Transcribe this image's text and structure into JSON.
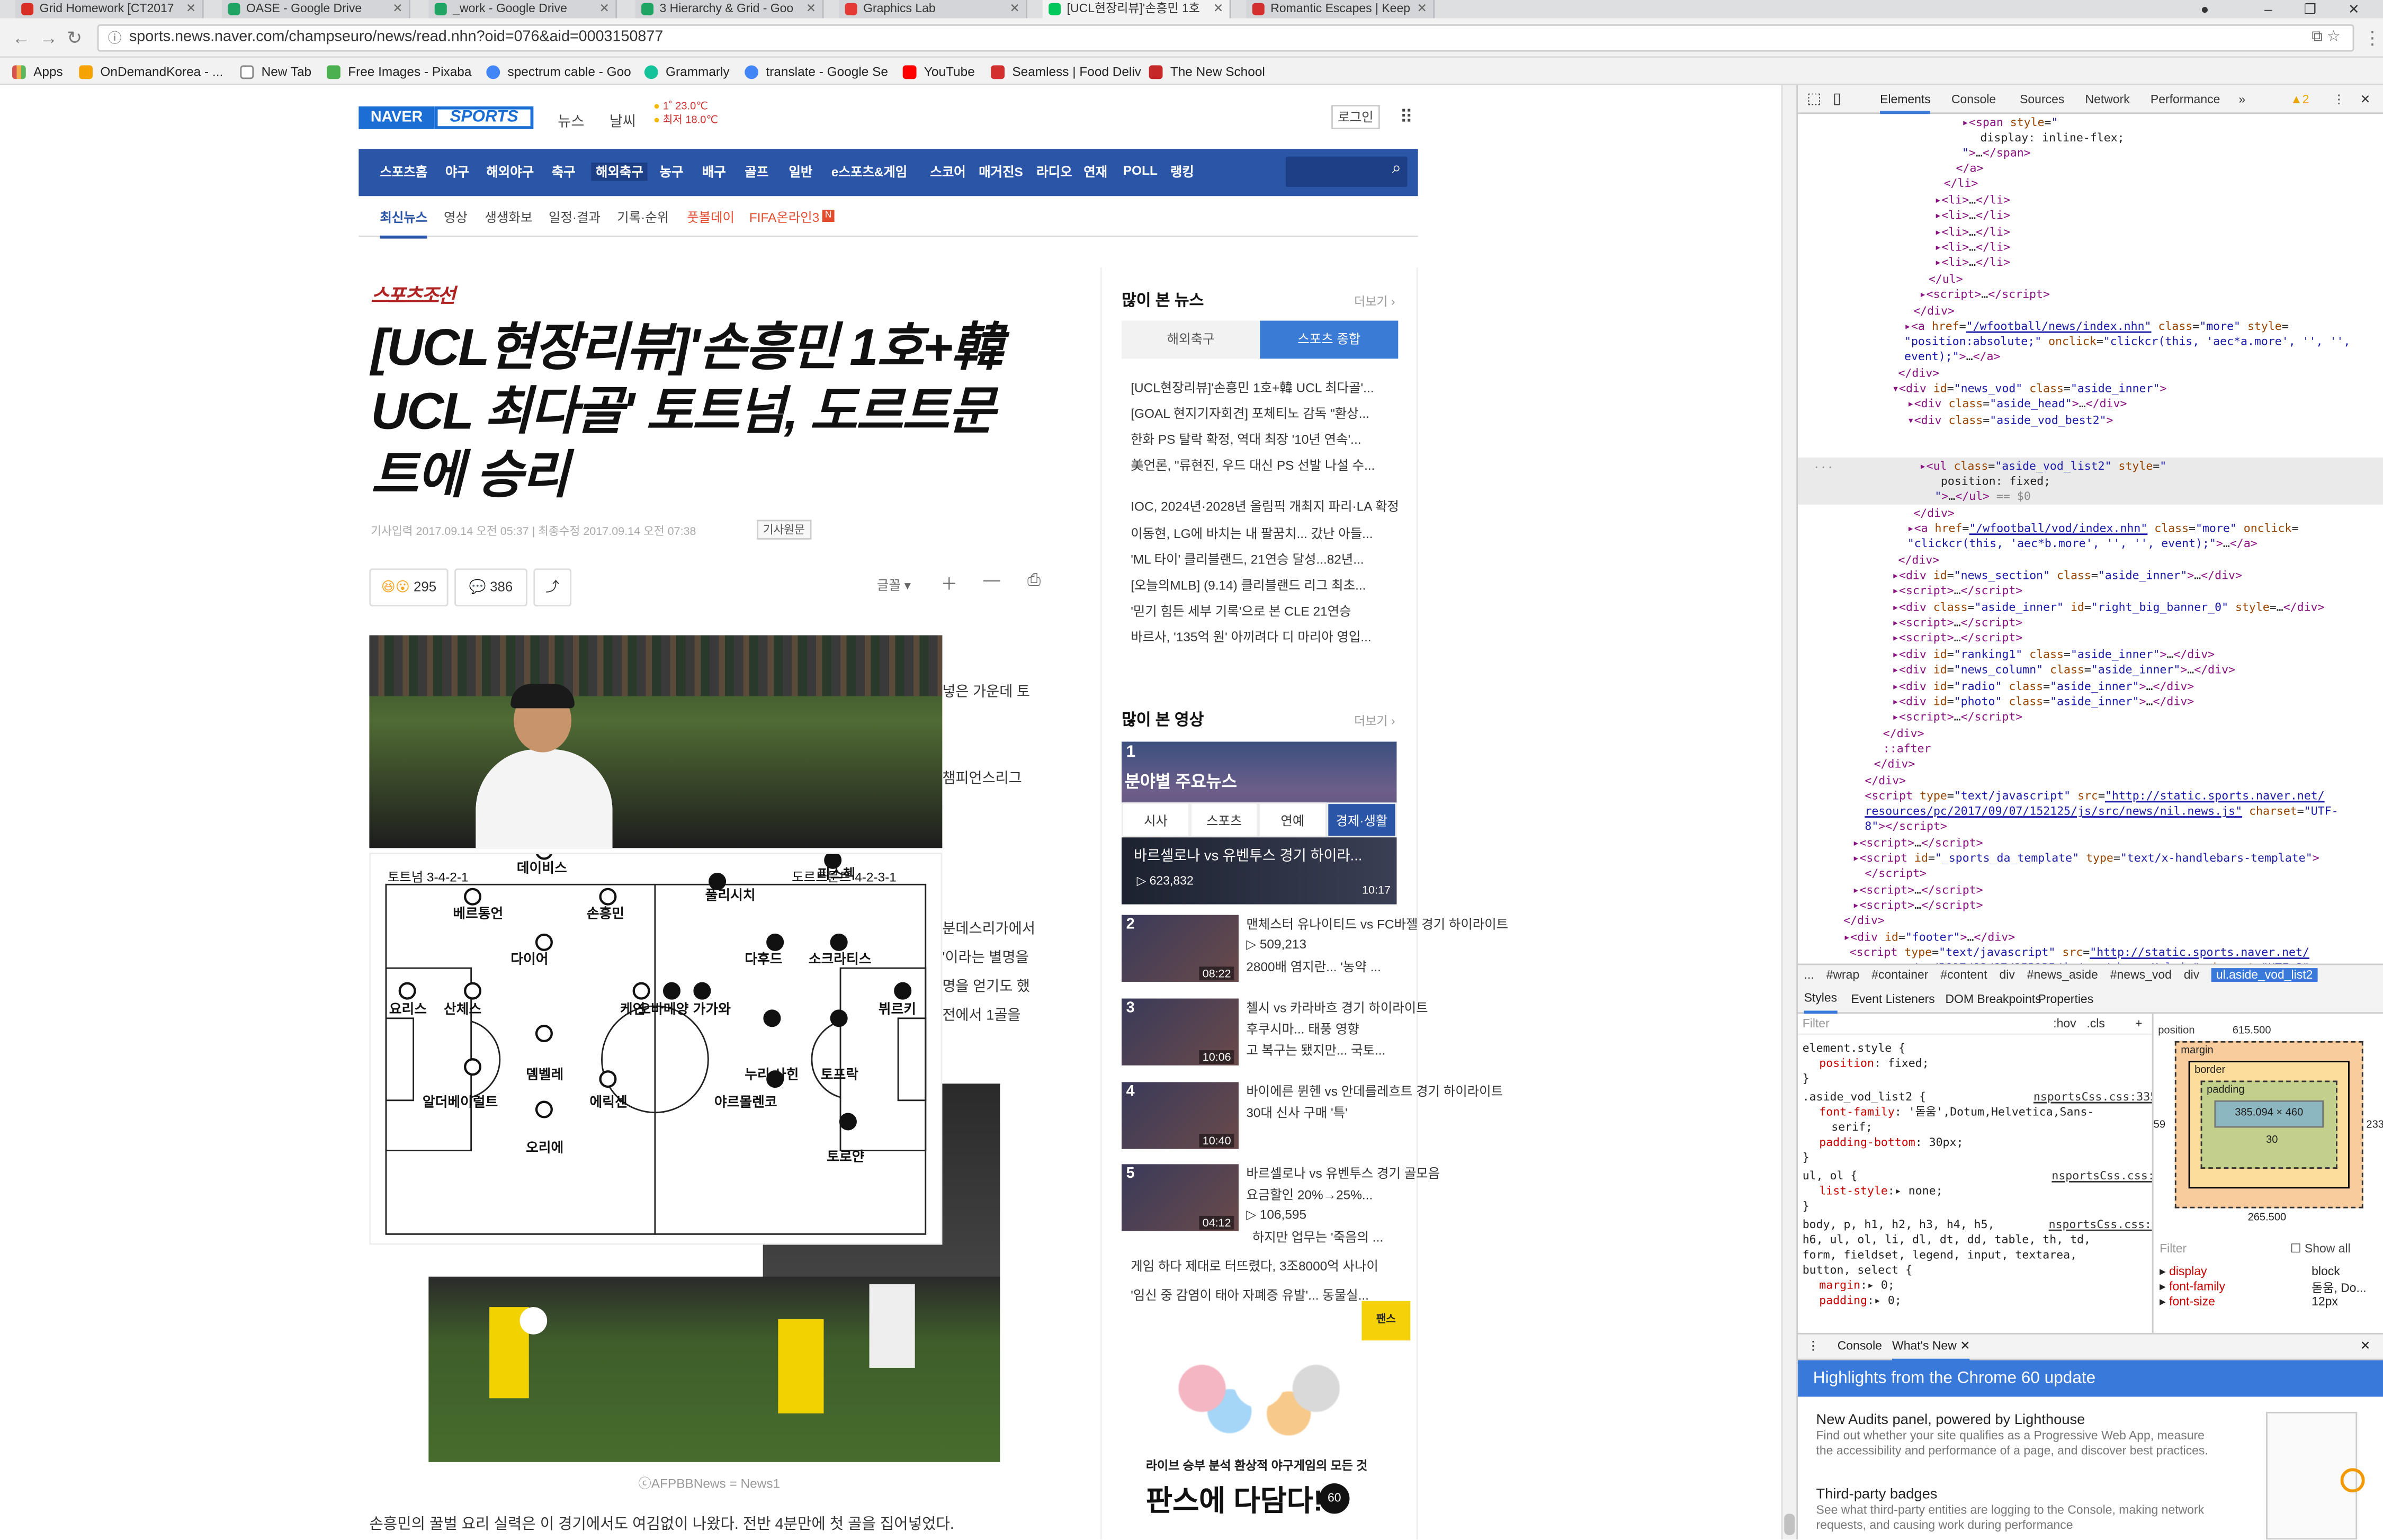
{
  "browser": {
    "tabs": [
      {
        "title": "Grid Homework [CT2017",
        "color": "#d93025"
      },
      {
        "title": "OASE - Google Drive",
        "color": "#1fa463"
      },
      {
        "title": "_work - Google Drive",
        "color": "#1fa463"
      },
      {
        "title": "3 Hierarchy & Grid - Goo",
        "color": "#1fa463"
      },
      {
        "title": "Graphics Lab",
        "color": "#e53935"
      },
      {
        "title": "[UCL현장리뷰]'손흥민 1호",
        "color": "#03c75a"
      },
      {
        "title": "Romantic Escapes | Keep",
        "color": "#d32f2f"
      }
    ],
    "url": "sports.news.naver.com/champseuro/news/read.nhn?oid=076&aid=0003150877",
    "bookmarks": [
      {
        "label": "Apps",
        "color": "#d9534f"
      },
      {
        "label": "OnDemandKorea - ...",
        "color": "#f4a300"
      },
      {
        "label": "New Tab",
        "color": "#ffffff"
      },
      {
        "label": "Free Images - Pixaba",
        "color": "#4caf50"
      },
      {
        "label": "spectrum cable - Goo",
        "color": "#4285f4"
      },
      {
        "label": "Grammarly",
        "color": "#15c39a"
      },
      {
        "label": "translate - Google Se",
        "color": "#4285f4"
      },
      {
        "label": "YouTube",
        "color": "#ff0000"
      },
      {
        "label": "Seamless | Food Deliv",
        "color": "#d32f2f"
      },
      {
        "label": "The New School",
        "color": "#c62828"
      }
    ]
  },
  "site": {
    "logo_naver": "NAVER",
    "logo_sports": "SPORTS",
    "nav_news": "뉴스",
    "nav_weather": "날씨",
    "weather_1": "1˚ 23.0℃",
    "weather_2": "최저 18.0℃",
    "login": "로그인",
    "gnb": [
      "스포츠홈",
      "야구",
      "해외야구",
      "축구",
      "해외축구",
      "농구",
      "배구",
      "골프",
      "일반",
      "e스포츠&게임",
      "스코어",
      "매거진S",
      "라디오",
      "연재",
      "POLL",
      "랭킹"
    ],
    "lnb": [
      "최신뉴스",
      "영상",
      "생생화보",
      "일정·결과",
      "기록·순위",
      "풋볼데이",
      "FIFA온라인3"
    ]
  },
  "article": {
    "press": "스포츠조선",
    "headline_1": "[UCL현장리뷰]'손흥민 1호+韓",
    "headline_2": "UCL 최다골' 토트넘, 도르트문",
    "headline_3": "트에 승리",
    "meta": "기사입력 2017.09.14 오전 05:37  |  최종수정 2017.09.14 오전 07:38",
    "original_btn": "기사원문",
    "reactions": "295",
    "comments": "386",
    "font_btn": "글꼴",
    "frag_1": "넣은 가운데 토",
    "frag_2": "챔피언스리그",
    "frag_3": "분데스리가에서",
    "frag_4": "'이라는 별명을",
    "frag_5": "명을 얻기도 했",
    "frag_6": "전에서 1골을",
    "caption": "ⓒAFPBBNews = News1",
    "body_last": "손흥민의 꿀벌 요리 실력은 이 경기에서도 여김없이 나왔다. 전반 4분만에 첫 골을 집어넣었다."
  },
  "formation": {
    "home_label": "토트넘  3-4-2-1",
    "away_label": "도르트문트  4-2-3-1",
    "home_players": [
      "요리스",
      "산체스",
      "베르통언",
      "다이어",
      "알더베이럴트",
      "데이비스",
      "손흥민",
      "뎀벨레",
      "에릭센",
      "오리에",
      "케인"
    ],
    "away_players": [
      "오바메양",
      "가가와",
      "풀리시치",
      "다후드",
      "누리 사힌",
      "야르몰렌코",
      "피스첵",
      "소크라티스",
      "토프락",
      "토로얀",
      "뷔르키"
    ]
  },
  "aside": {
    "popular_title": "많이 본 뉴스",
    "more": "더보기",
    "seg_tabs": [
      "해외축구",
      "스포츠 종합"
    ],
    "popular_items": [
      "[UCL현장리뷰]'손흥민 1호+韓 UCL 최다골'...",
      "[GOAL 현지기자회견] 포체티노 감독 \"환상...",
      "한화 PS 탈락 확정, 역대 최장 '10년 연속'...",
      "美언론, \"류현진, 우드 대신 PS 선발 나설 수...",
      "IOC, 2024년·2028년 올림픽 개최지 파리·LA 확정",
      "이동현, LG에 바치는 내 팔꿈치... 갔난 아들...",
      "'ML 타이' 클리블랜드, 21연승 달성...82년...",
      "[오늘의MLB] (9.14) 클리블랜드 리그 최초...",
      "'믿기 힘든 세부 기록'으로 본 CLE 21연승",
      "바르사, '135억 원' 아끼려다 디 마리아 영입..."
    ],
    "video_title": "많이 본 영상",
    "vod_categories": [
      "시사",
      "스포츠",
      "연예",
      "경제·생활"
    ],
    "vod_main_overlay": "분야별 주요뉴스",
    "vod_main_caption": "바르셀로나 vs 유벤투스 경기 하이라...",
    "vod_main_views": "▷ 623,832",
    "vod_main_time": "10:17",
    "videos": [
      {
        "num": "2",
        "time": "08:22",
        "line1": "맨체스터 유나이티드 vs FC바젤 경기 하이라이트",
        "line2": "▷ 509,213",
        "line3": "2800배 염지란... '농약 ..."
      },
      {
        "num": "3",
        "time": "10:06",
        "line1": "첼시 vs 카라바흐 경기 하이라이트",
        "line2": "후쿠시마... 태풍 영향",
        "line3": "고 복구는 됐지만... 국토..."
      },
      {
        "num": "4",
        "time": "10:40",
        "line1": "바이에른 뮌헨 vs 안데를레흐트 경기 하이라이트",
        "line2": "30대 신사 구매 '특'",
        "line3": ""
      },
      {
        "num": "5",
        "time": "04:12",
        "line1": "바르셀로나 vs 유벤투스 경기 골모음",
        "line2": "요금할인 20%→25%...",
        "line3": "▷ 106,595"
      }
    ],
    "extra_news": [
      "하지만 업무는 '죽음의 ...",
      "게임 하다 제대로 터뜨렸다, 3조8000억 사나이",
      "'임신 중 감염이 태아 자폐증 유발'... 동물실..."
    ],
    "banner_text": "라이브 승부 분석 환상적 야구게임의 모든 것",
    "banner_big": "판스에 다담다!",
    "banner_badge": "60"
  },
  "devtools": {
    "tabs": [
      "Elements",
      "Console",
      "Sources",
      "Network",
      "Performance"
    ],
    "warning_count": "2",
    "breadcrumbs": [
      "...",
      "#wrap",
      "#container",
      "#content",
      "div",
      "#news_aside",
      "#news_vod",
      "div",
      "ul.aside_vod_list2"
    ],
    "style_tabs": [
      "Styles",
      "Event Listeners",
      "DOM Breakpoints",
      "Properties"
    ],
    "filter": "Filter",
    "hov": ":hov",
    "cls": ".cls",
    "box_position": "position",
    "box_outer": "615.500",
    "box_margin": "margin",
    "box_border": "border",
    "box_padding": "padding",
    "box_content": "385.094 × 460",
    "box_pad_bottom": "30",
    "box_left": "59",
    "box_right": "233.906",
    "box_bottom": "265.500",
    "computed_filter": "Filter",
    "show_all": "Show all",
    "computed": [
      {
        "p": "display",
        "v": "block"
      },
      {
        "p": "font-family",
        "v": "돋움, Do..."
      },
      {
        "p": "font-size",
        "v": "12px"
      }
    ],
    "drawer_tabs": [
      "Console",
      "What's New"
    ],
    "whats_new": "Highlights from the Chrome 60 update",
    "items": [
      {
        "title": "New Audits panel, powered by Lighthouse",
        "desc": "Find out whether your site qualifies as a Progressive Web App, measure the accessibility and performance of a page, and discover best practices."
      },
      {
        "title": "Third-party badges",
        "desc": "See what third-party entities are logging to the Console, making network requests, and causing work during performance"
      }
    ]
  }
}
